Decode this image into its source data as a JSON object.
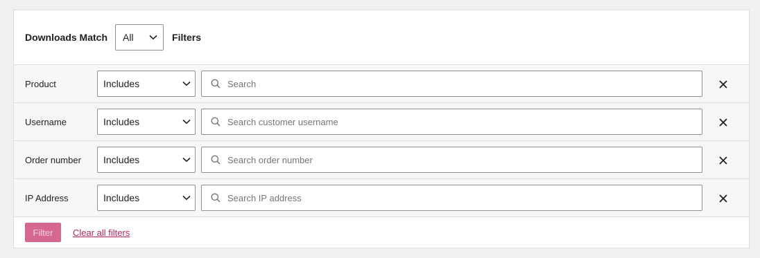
{
  "header": {
    "label": "Downloads Match",
    "match_value": "All",
    "filters_label": "Filters"
  },
  "rows": [
    {
      "label": "Product",
      "rule": "Includes",
      "placeholder": "Search"
    },
    {
      "label": "Username",
      "rule": "Includes",
      "placeholder": "Search customer username"
    },
    {
      "label": "Order number",
      "rule": "Includes",
      "placeholder": "Search order number"
    },
    {
      "label": "IP Address",
      "rule": "Includes",
      "placeholder": "Search IP address"
    }
  ],
  "footer": {
    "filter_button": "Filter",
    "clear_link": "Clear all filters"
  },
  "colors": {
    "accent": "#d66791",
    "link": "#b0235e",
    "row_bg": "#f6f7f7",
    "border": "#dcdcde"
  },
  "icons": {
    "search": "search-icon",
    "chevron": "chevron-down-icon",
    "remove": "close-icon"
  }
}
